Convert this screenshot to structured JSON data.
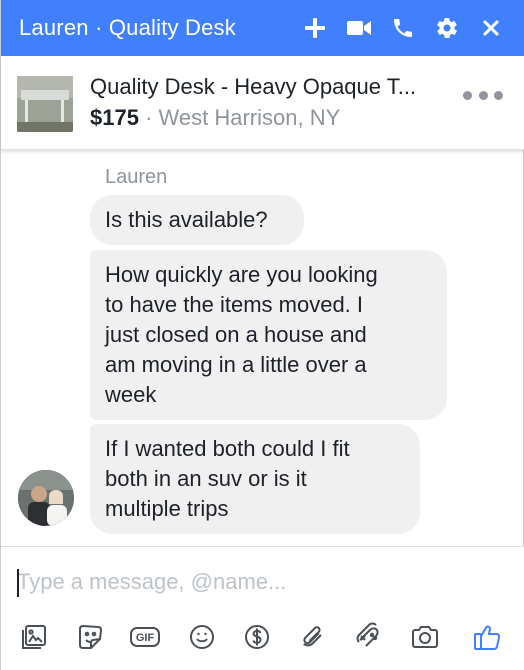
{
  "header": {
    "title": "Lauren · Quality Desk",
    "color": "#4080ff",
    "icons": [
      "plus-icon",
      "video-camera-icon",
      "phone-icon",
      "gear-icon",
      "close-icon"
    ]
  },
  "product": {
    "title": "Quality Desk - Heavy Opaque T...",
    "price": "$175",
    "separator": "·",
    "location": "West Harrison, NY"
  },
  "conversation": {
    "sender": "Lauren",
    "messages": [
      {
        "lines": [
          "Is this available?"
        ]
      },
      {
        "lines": [
          "How quickly are you looking",
          "to have the items moved. I",
          "just closed on a house and",
          "am moving in a little over a",
          "week"
        ]
      },
      {
        "lines": [
          "If I wanted both could I fit",
          "both in an suv or is it",
          "multiple trips"
        ]
      }
    ]
  },
  "composer": {
    "placeholder": "Type a message, @name...",
    "value": "",
    "tools": [
      "photo-icon",
      "sticker-icon",
      "gif-icon",
      "emoji-icon",
      "payment-icon",
      "attachment-icon",
      "game-icon",
      "camera-icon",
      "like-icon"
    ],
    "gif_label": "GIF",
    "accent": "#4080ff"
  }
}
